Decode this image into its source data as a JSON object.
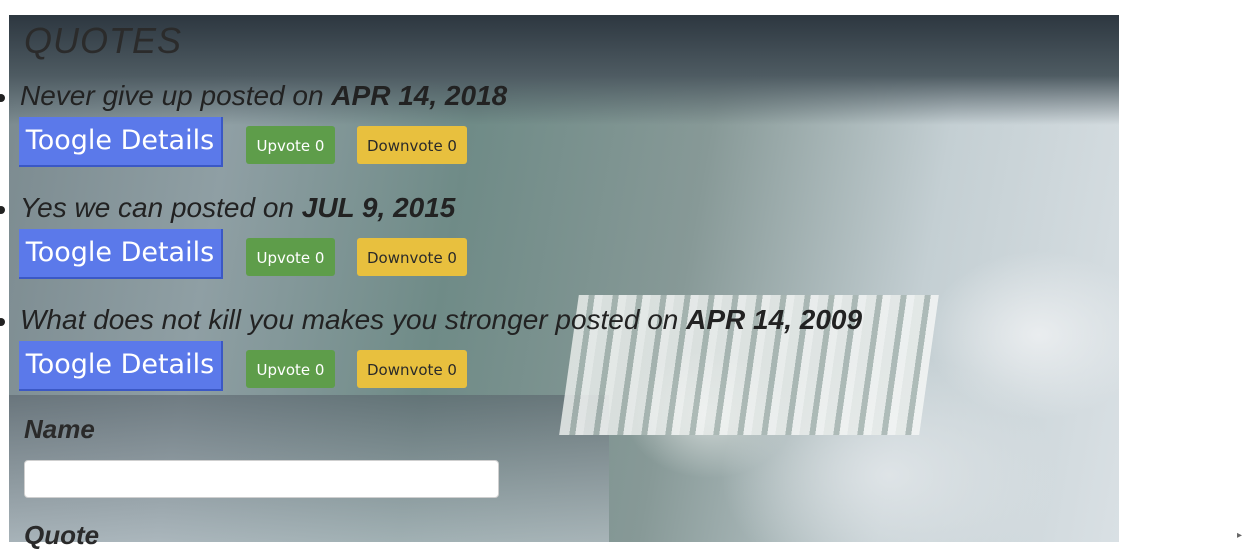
{
  "page": {
    "heading": "QUOTES",
    "posted_word": "posted on",
    "accent_colors": {
      "toggle": "#5b79ea",
      "upvote": "#5e9d4a",
      "downvote": "#e8c03e"
    }
  },
  "quotes": [
    {
      "text": "Never give up",
      "date": "APR 14, 2018",
      "toggle_label": "Toogle Details",
      "upvote_label": "Upvote 0",
      "downvote_label": "Downvote 0"
    },
    {
      "text": "Yes we can",
      "date": "JUL 9, 2015",
      "toggle_label": "Toogle Details",
      "upvote_label": "Upvote 0",
      "downvote_label": "Downvote 0"
    },
    {
      "text": "What does not kill you makes you stronger",
      "date": "APR 14, 2009",
      "toggle_label": "Toogle Details",
      "upvote_label": "Upvote 0",
      "downvote_label": "Downvote 0"
    }
  ],
  "form": {
    "name_label": "Name",
    "name_value": "",
    "quote_label": "Quote"
  }
}
